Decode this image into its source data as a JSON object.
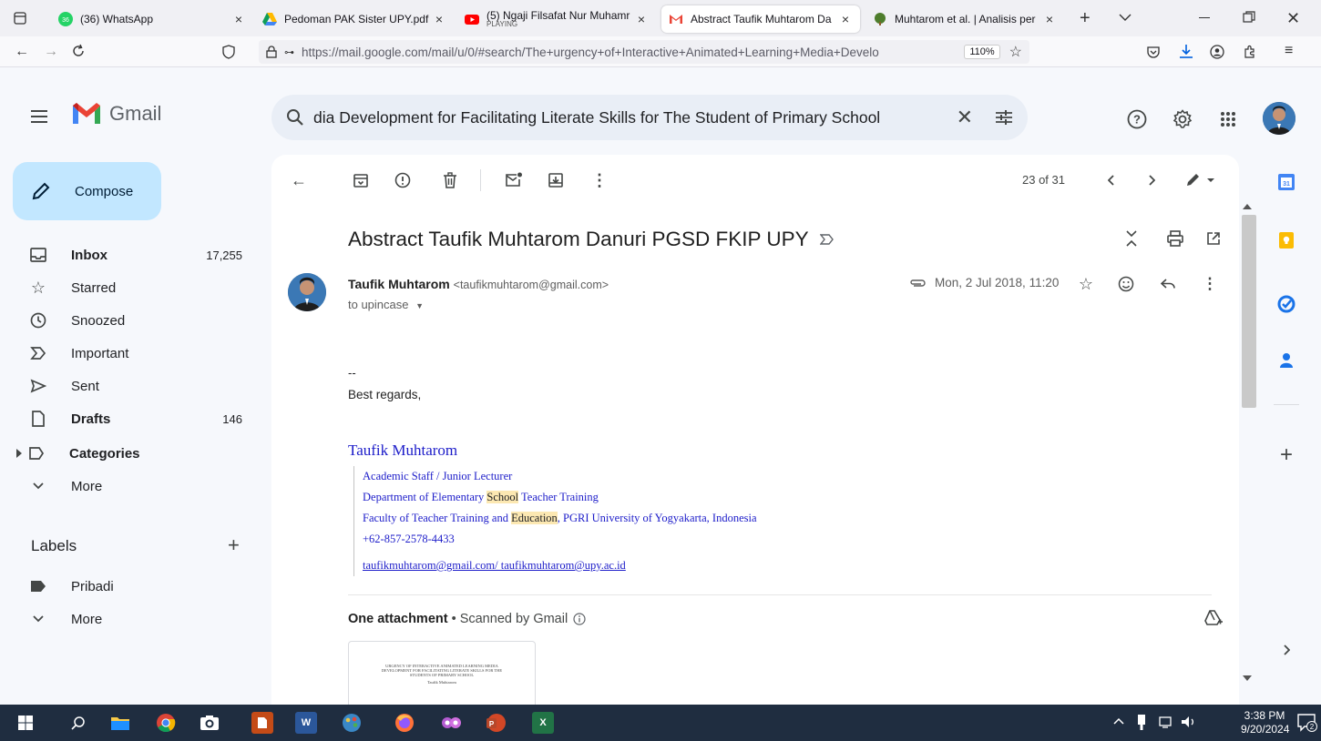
{
  "browser": {
    "tabs": [
      {
        "title": "(36) WhatsApp",
        "badge": "36"
      },
      {
        "title": "Pedoman PAK Sister UPY.pdf"
      },
      {
        "title": "(5) Ngaji Filsafat Nur Muhamr",
        "subtitle": "PLAYING"
      },
      {
        "title": "Abstract Taufik Muhtarom Da"
      },
      {
        "title": "Muhtarom et al. | Analisis per"
      }
    ],
    "new_tab": "+",
    "url": "https://mail.google.com/mail/u/0/#search/The+urgency+of+Interactive+Animated+Learning+Media+Develo",
    "url_host": "google.com",
    "zoom": "110%"
  },
  "gmail": {
    "app_name": "Gmail",
    "search_query": "dia Development for Facilitating Literate Skills for The Student of Primary School",
    "compose_label": "Compose",
    "nav": [
      {
        "label": "Inbox",
        "count": "17,255",
        "bold": true
      },
      {
        "label": "Starred",
        "count": ""
      },
      {
        "label": "Snoozed",
        "count": ""
      },
      {
        "label": "Important",
        "count": ""
      },
      {
        "label": "Sent",
        "count": ""
      },
      {
        "label": "Drafts",
        "count": "146",
        "bold": true
      },
      {
        "label": "Categories",
        "count": "",
        "bold": true
      },
      {
        "label": "More",
        "count": ""
      }
    ],
    "labels_title": "Labels",
    "labels": [
      {
        "label": "Pribadi"
      },
      {
        "label": "More"
      }
    ]
  },
  "message": {
    "counter": "23 of 31",
    "subject": "Abstract Taufik Muhtarom Danuri PGSD FKIP UPY",
    "sender_name": "Taufik Muhtarom",
    "sender_email": "<taufikmuhtarom@gmail.com>",
    "to": "to upincase",
    "date": "Mon, 2 Jul 2018, 11:20",
    "body_dash": "--",
    "body_regards": "Best regards,",
    "signature": {
      "name": "Taufik Muhtarom",
      "line1": "Academic Staff / Junior Lecturer",
      "line2_a": "Department of Elementary ",
      "line2_hl": "School",
      "line2_b": " Teacher Training",
      "line3_a": "Faculty of Teacher Training and ",
      "line3_hl": "Education",
      "line3_b": ", PGRI  University of Yogyakarta, Indonesia",
      "phone": "+62-857-2578-4433",
      "emails": "taufikmuhtarom@gmail.com/ taufikmuhtarom@upy.ac.id"
    },
    "attachment_title": "One attachment",
    "attachment_scan": "• Scanned by Gmail",
    "attachment_preview": "URGENCY OF INTERACTIVE ANIMATED LEARNING MEDIA DEVELOPMENT FOR FACILITATING LITERATE SKILLS FOR THE STUDENTS OF PRIMARY SCHOOL",
    "attachment_preview_author": "Taufik Muhtarom"
  },
  "taskbar": {
    "time": "3:38 PM",
    "date": "9/20/2024",
    "notifications": "2"
  },
  "colors": {
    "compose": "#c2e7ff",
    "search": "#e9eef6",
    "signature_blue": "#1c1cc9",
    "highlight": "#fce8b2",
    "taskbar": "#1f2d40"
  }
}
